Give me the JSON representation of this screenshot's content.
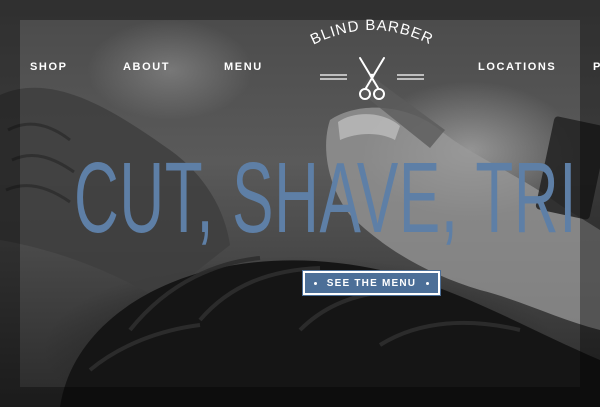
{
  "nav": {
    "items": [
      {
        "label": "SHOP"
      },
      {
        "label": "ABOUT"
      },
      {
        "label": "MENU"
      },
      {
        "label": "LOCATIONS"
      },
      {
        "label": "P"
      }
    ]
  },
  "logo": {
    "brand": "BLIND BARBER",
    "icon": "scissors-icon"
  },
  "hero": {
    "headline": "CUT, SHAVE, TRI",
    "cta_label": "SEE THE MENU"
  },
  "colors": {
    "accent": "#4c6f98",
    "headline": "#5e7fa6",
    "nav_text": "#ffffff"
  }
}
